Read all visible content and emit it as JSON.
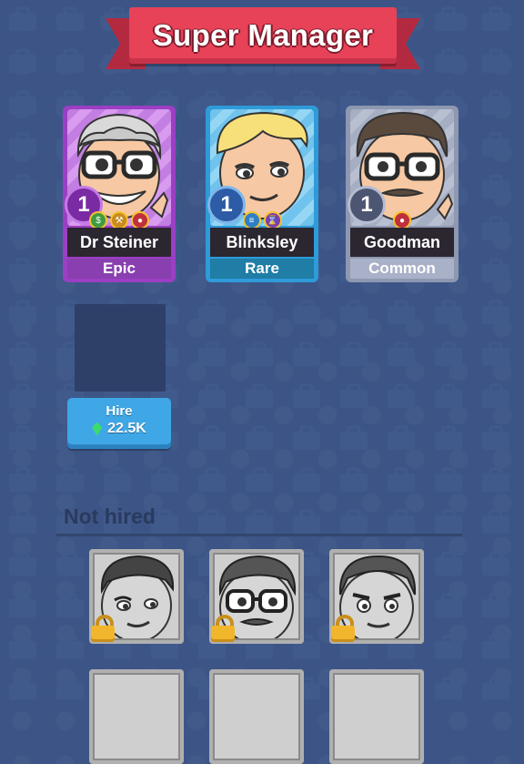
{
  "header": {
    "title": "Super Manager"
  },
  "managers": [
    {
      "name": "Dr Steiner",
      "rarity": "Epic",
      "level": "1"
    },
    {
      "name": "Blinksley",
      "rarity": "Rare",
      "level": "1"
    },
    {
      "name": "Goodman",
      "rarity": "Common",
      "level": "1"
    }
  ],
  "hire": {
    "label": "Hire",
    "price": "22.5K"
  },
  "not_hired": {
    "title": "Not hired"
  },
  "colors": {
    "epic": "#9b3fc4",
    "rare": "#2f9bd9",
    "common": "#8e98b1",
    "banner": "#e84258",
    "background": "#3c5586",
    "hire_button": "#3fa7e6"
  }
}
